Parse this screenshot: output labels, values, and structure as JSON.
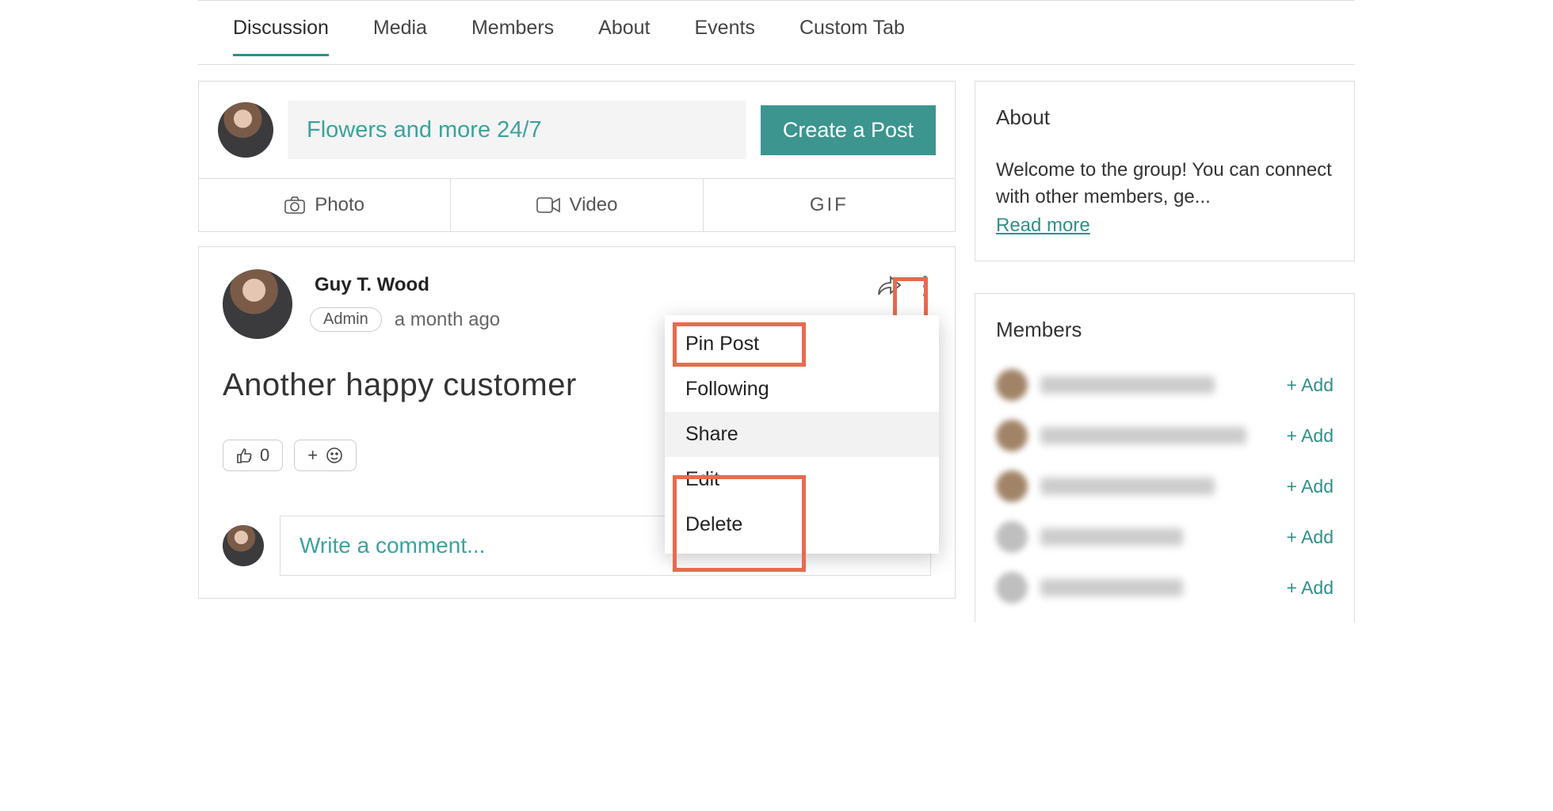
{
  "tabs": {
    "items": [
      "Discussion",
      "Media",
      "Members",
      "About",
      "Events",
      "Custom Tab"
    ],
    "active": 0
  },
  "composer": {
    "placeholder": "Flowers and more 24/7",
    "create_label": "Create a Post",
    "actions": {
      "photo": "Photo",
      "video": "Video",
      "gif": "GIF"
    }
  },
  "post": {
    "author": "Guy T. Wood",
    "badge": "Admin",
    "time": "a month ago",
    "body": "Another happy customer",
    "like_count": "0",
    "add_reaction_plus": "+"
  },
  "post_menu": {
    "pin": "Pin Post",
    "following": "Following",
    "share": "Share",
    "edit": "Edit",
    "delete": "Delete"
  },
  "comment": {
    "placeholder": "Write a comment..."
  },
  "sidebar": {
    "about_title": "About",
    "about_text": "Welcome to the group! You can connect with other members, ge...",
    "read_more": "Read more",
    "members_title": "Members",
    "add_label": "+ Add",
    "member_count_visible": 5
  }
}
